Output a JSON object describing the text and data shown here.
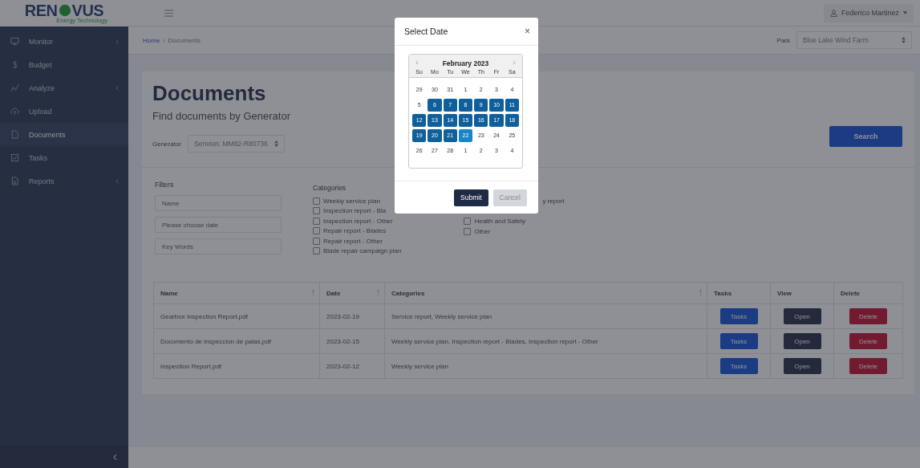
{
  "logo": {
    "left": "REN",
    "right": "VUS",
    "tagline": "Energy Technology"
  },
  "user": {
    "name": "Federico Martinez"
  },
  "sidebar": {
    "items": [
      {
        "label": "Monitor",
        "kind": "monitor",
        "has_submenu": true,
        "selected": false
      },
      {
        "label": "Budget",
        "kind": "dollar",
        "has_submenu": false,
        "selected": false
      },
      {
        "label": "Analyze",
        "kind": "chart",
        "has_submenu": true,
        "selected": false
      },
      {
        "label": "Upload",
        "kind": "cloud",
        "has_submenu": false,
        "selected": false
      },
      {
        "label": "Documents",
        "kind": "file",
        "has_submenu": false,
        "selected": true
      },
      {
        "label": "Tasks",
        "kind": "check",
        "has_submenu": false,
        "selected": false
      },
      {
        "label": "Reports",
        "kind": "report",
        "has_submenu": true,
        "selected": false
      }
    ]
  },
  "breadcrumb": {
    "home": "Home",
    "separator": "/",
    "current": "Documents"
  },
  "park": {
    "label": "Park",
    "value": "Blue Lake Wind Farm"
  },
  "page": {
    "title": "Documents",
    "subtitle": "Find documents by Generator",
    "generator_label": "Generator",
    "generator_value": "Senvion: MM82-R80736",
    "search_button": "Search"
  },
  "filters": {
    "title": "Filters",
    "fields": [
      {
        "placeholder": "Name"
      },
      {
        "placeholder": "Please choose date"
      },
      {
        "placeholder": "Key Words"
      }
    ]
  },
  "categories": {
    "title": "Categories",
    "left": [
      {
        "label": "Weekly service plan",
        "checked": false
      },
      {
        "label": "Inspection report - Bla",
        "checked": false
      },
      {
        "label": "Inspection report - Other",
        "checked": false
      },
      {
        "label": "Repair report - Blades",
        "checked": false
      },
      {
        "label": "Repair report - Other",
        "checked": false
      },
      {
        "label": "Blade repair campaign plan",
        "checked": false
      }
    ],
    "right": [
      {
        "kind": "cut",
        "label": "y report",
        "checked": false
      },
      {
        "kind": "checkbox",
        "label": "Health and Safety",
        "checked": false
      },
      {
        "kind": "checkbox",
        "label": "Other",
        "checked": false
      }
    ]
  },
  "table": {
    "columns": [
      {
        "label": "Name",
        "sortable": true
      },
      {
        "label": "Date",
        "sortable": true
      },
      {
        "label": "Categories",
        "sortable": true
      },
      {
        "label": "Tasks",
        "sortable": false
      },
      {
        "label": "View",
        "sortable": false
      },
      {
        "label": "Delete",
        "sortable": false
      }
    ],
    "rows": [
      {
        "name": "Gearbox Inspection Report.pdf",
        "date": "2023-02-19",
        "categories": "Service report, Weekly service plan",
        "tasks": "Tasks",
        "view": "Open",
        "delete": "Delete"
      },
      {
        "name": "Documento de inspeccion de palas.pdf",
        "date": "2023-02-15",
        "categories": "Weekly service plan, Inspection report - Blades, Inspection report - Other",
        "tasks": "Tasks",
        "view": "Open",
        "delete": "Delete"
      },
      {
        "name": "Inspection Report.pdf",
        "date": "2023-02-12",
        "categories": "Weekly service plan",
        "tasks": "Tasks",
        "view": "Open",
        "delete": "Delete"
      }
    ]
  },
  "modal": {
    "title": "Select Date",
    "close": "×",
    "calendar": {
      "month": "February 2023",
      "prev": "‹",
      "next": "›",
      "weekdays": [
        "Su",
        "Mo",
        "Tu",
        "We",
        "Th",
        "Fr",
        "Sa"
      ],
      "weeks": [
        [
          {
            "d": "29",
            "in_range": false,
            "selected": false
          },
          {
            "d": "30",
            "in_range": false,
            "selected": false
          },
          {
            "d": "31",
            "in_range": false,
            "selected": false
          },
          {
            "d": "1",
            "in_range": false,
            "selected": false
          },
          {
            "d": "2",
            "in_range": false,
            "selected": false
          },
          {
            "d": "3",
            "in_range": false,
            "selected": false
          },
          {
            "d": "4",
            "in_range": false,
            "selected": false
          }
        ],
        [
          {
            "d": "5",
            "in_range": false,
            "selected": false
          },
          {
            "d": "6",
            "in_range": true,
            "selected": false
          },
          {
            "d": "7",
            "in_range": true,
            "selected": false
          },
          {
            "d": "8",
            "in_range": true,
            "selected": false
          },
          {
            "d": "9",
            "in_range": true,
            "selected": false
          },
          {
            "d": "10",
            "in_range": true,
            "selected": false
          },
          {
            "d": "11",
            "in_range": true,
            "selected": false
          }
        ],
        [
          {
            "d": "12",
            "in_range": true,
            "selected": false
          },
          {
            "d": "13",
            "in_range": true,
            "selected": false
          },
          {
            "d": "14",
            "in_range": true,
            "selected": false
          },
          {
            "d": "15",
            "in_range": true,
            "selected": false
          },
          {
            "d": "16",
            "in_range": true,
            "selected": false
          },
          {
            "d": "17",
            "in_range": true,
            "selected": false
          },
          {
            "d": "18",
            "in_range": true,
            "selected": false
          }
        ],
        [
          {
            "d": "19",
            "in_range": true,
            "selected": false
          },
          {
            "d": "20",
            "in_range": true,
            "selected": false
          },
          {
            "d": "21",
            "in_range": true,
            "selected": false
          },
          {
            "d": "22",
            "in_range": true,
            "selected": true
          },
          {
            "d": "23",
            "in_range": false,
            "selected": false
          },
          {
            "d": "24",
            "in_range": false,
            "selected": false
          },
          {
            "d": "25",
            "in_range": false,
            "selected": false
          }
        ],
        [
          {
            "d": "26",
            "in_range": false,
            "selected": false
          },
          {
            "d": "27",
            "in_range": false,
            "selected": false
          },
          {
            "d": "28",
            "in_range": false,
            "selected": false
          },
          {
            "d": "1",
            "in_range": false,
            "selected": false
          },
          {
            "d": "2",
            "in_range": false,
            "selected": false
          },
          {
            "d": "3",
            "in_range": false,
            "selected": false
          },
          {
            "d": "4",
            "in_range": false,
            "selected": false
          }
        ]
      ]
    },
    "buttons": [
      {
        "label": "Submit",
        "kind": "primary"
      },
      {
        "label": "Cancel",
        "kind": "secondary"
      }
    ]
  }
}
